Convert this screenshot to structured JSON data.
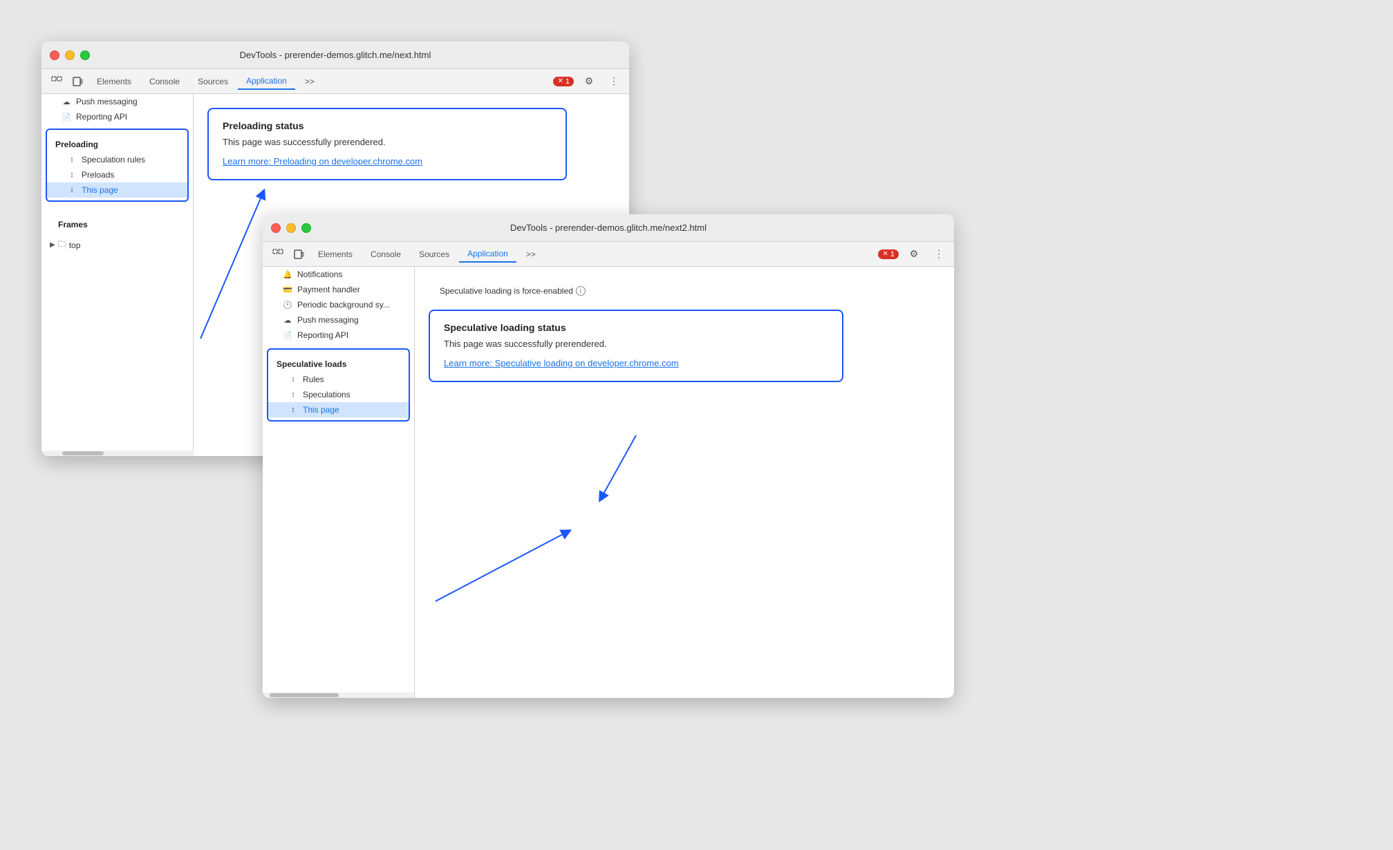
{
  "window1": {
    "title": "DevTools - prerender-demos.glitch.me/next.html",
    "controls": {
      "close": "close",
      "minimize": "minimize",
      "maximize": "maximize"
    },
    "tabs": [
      {
        "label": "Elements",
        "active": false
      },
      {
        "label": "Console",
        "active": false
      },
      {
        "label": "Sources",
        "active": false
      },
      {
        "label": "Application",
        "active": true
      }
    ],
    "tabs_overflow": ">>",
    "error_count": "1",
    "sidebar": {
      "push_messaging": "Push messaging",
      "reporting_api": "Reporting API",
      "preloading_section": "Preloading",
      "preloading_items": [
        {
          "label": "Speculation rules",
          "active": false
        },
        {
          "label": "Preloads",
          "active": false
        },
        {
          "label": "This page",
          "active": true
        }
      ],
      "frames_section": "Frames",
      "frames_top": "top"
    },
    "main": {
      "status_card": {
        "title": "Preloading status",
        "text": "This page was successfully prerendered.",
        "link": "Learn more: Preloading on developer.chrome.com"
      }
    }
  },
  "window2": {
    "title": "DevTools - prerender-demos.glitch.me/next2.html",
    "controls": {
      "close": "close",
      "minimize": "minimize",
      "maximize": "maximize"
    },
    "tabs": [
      {
        "label": "Elements",
        "active": false
      },
      {
        "label": "Console",
        "active": false
      },
      {
        "label": "Sources",
        "active": false
      },
      {
        "label": "Application",
        "active": true
      }
    ],
    "tabs_overflow": ">>",
    "error_count": "1",
    "sidebar": {
      "notifications": "Notifications",
      "payment_handler": "Payment handler",
      "periodic_background": "Periodic background sy...",
      "push_messaging": "Push messaging",
      "reporting_api": "Reporting API",
      "speculative_loads_section": "Speculative loads",
      "speculative_items": [
        {
          "label": "Rules",
          "active": false
        },
        {
          "label": "Speculations",
          "active": false
        },
        {
          "label": "This page",
          "active": true
        }
      ]
    },
    "main": {
      "force_enabled_notice": "Speculative loading is force-enabled",
      "status_card": {
        "title": "Speculative loading status",
        "text": "This page was successfully prerendered.",
        "link": "Learn more: Speculative loading on developer.chrome.com"
      }
    }
  },
  "icons": {
    "inspect": "⊞",
    "device": "⊡",
    "settings": "⚙",
    "more": "⋮",
    "arrow_updown": "↕",
    "folder": "🗀",
    "chevron_right": "▶",
    "push": "☁",
    "doc": "📄",
    "payment": "💳",
    "clock": "🕐",
    "x_circle": "✕"
  },
  "colors": {
    "blue_border": "#1a56ff",
    "tab_active": "#1a73e8",
    "active_bg": "#d0e4fd",
    "error_red": "#d93025"
  }
}
